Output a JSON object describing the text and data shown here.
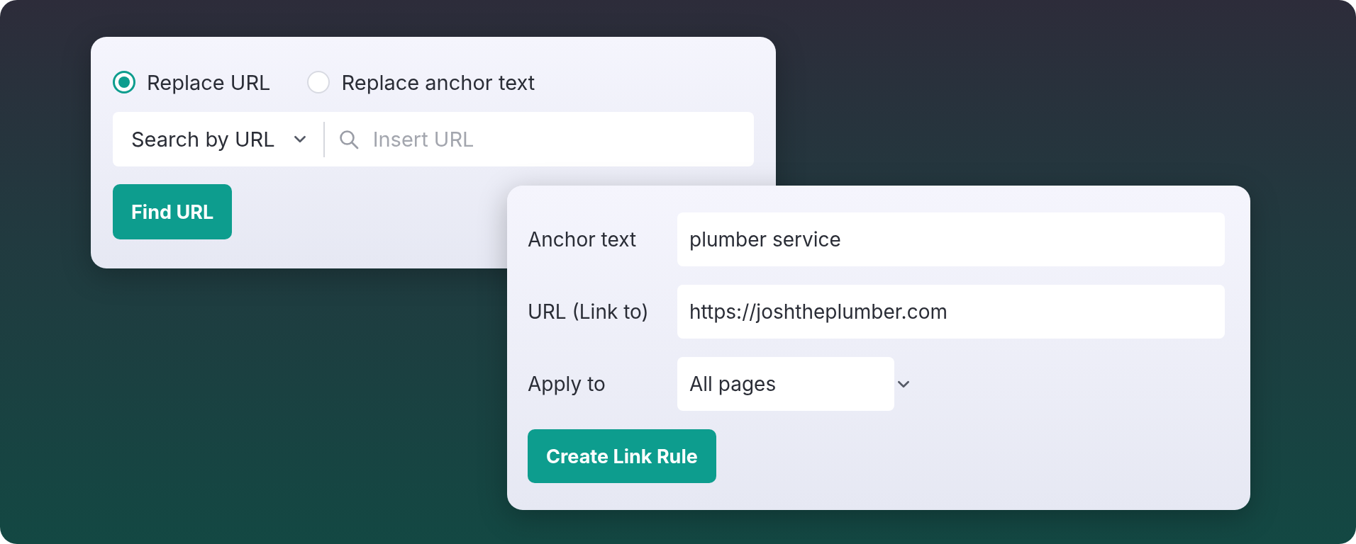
{
  "mode_options": [
    {
      "label": "Replace URL",
      "selected": true
    },
    {
      "label": "Replace anchor text",
      "selected": false
    }
  ],
  "search": {
    "dropdown": "Search by URL",
    "placeholder": "Insert URL"
  },
  "find_button": "Find URL",
  "rule_form": {
    "fields": [
      {
        "kind": "text",
        "label": "Anchor text",
        "value": "plumber service"
      },
      {
        "kind": "text",
        "label": "URL (Link to)",
        "value": "https://joshtheplumber.com"
      },
      {
        "kind": "select",
        "label": "Apply to",
        "value": "All pages"
      }
    ],
    "submit": "Create Link Rule"
  }
}
